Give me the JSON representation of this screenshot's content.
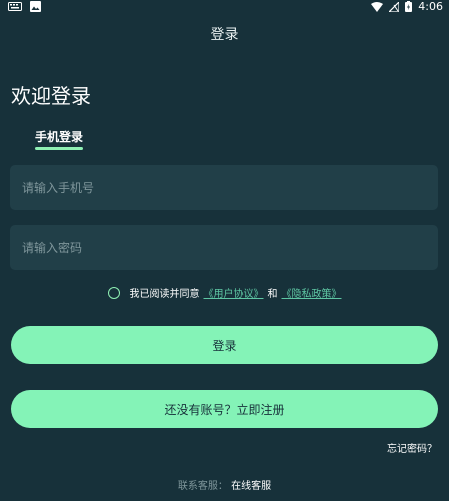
{
  "status": {
    "time": "4:06"
  },
  "header": {
    "title": "登录"
  },
  "welcome": "欢迎登录",
  "tab": {
    "label": "手机登录"
  },
  "form": {
    "phone_placeholder": "请输入手机号",
    "password_placeholder": "请输入密码"
  },
  "agreement": {
    "prefix": "我已阅读并同意",
    "user_agreement": "《用户协议》",
    "and": "和",
    "privacy": "《隐私政策》"
  },
  "buttons": {
    "login": "登录",
    "register": "还没有账号？立即注册"
  },
  "forgot": "忘记密码？",
  "support": {
    "label": "联系客服：",
    "link": "在线客服"
  },
  "colors": {
    "background": "#17313a",
    "accent": "#84f3b7",
    "input": "#213f48"
  }
}
